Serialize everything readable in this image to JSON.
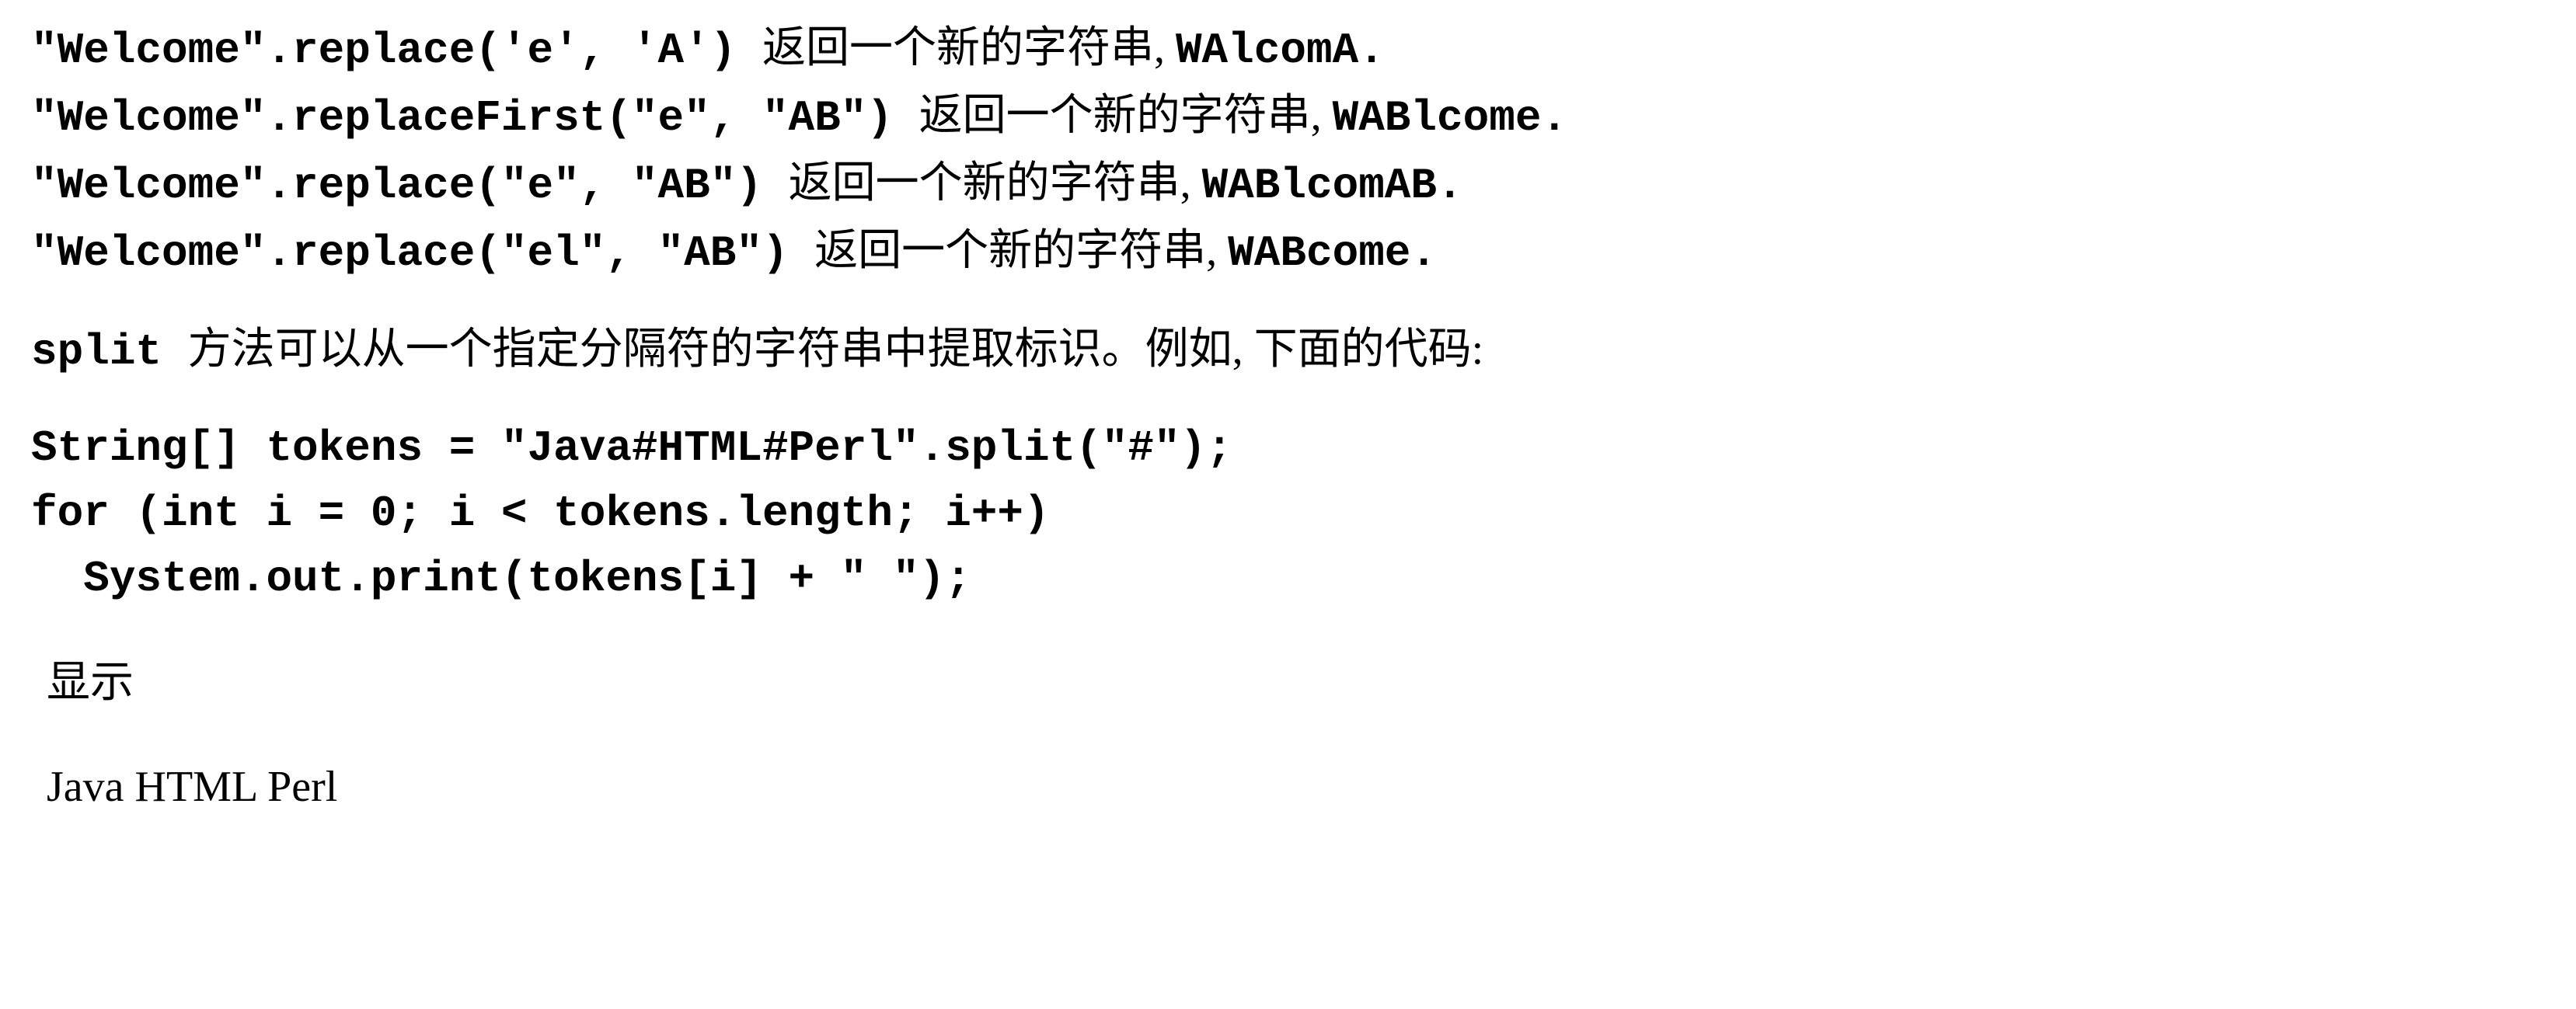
{
  "examples": [
    {
      "code": "\"Welcome\".replace('e', 'A') ",
      "cn": "返回一个新的字符串, ",
      "result": "WAlcomA."
    },
    {
      "code": "\"Welcome\".replaceFirst(\"e\", \"AB\") ",
      "cn": "返回一个新的字符串, ",
      "result": "WABlcome."
    },
    {
      "code": "\"Welcome\".replace(\"e\", \"AB\") ",
      "cn": "返回一个新的字符串, ",
      "result": "WABlcomAB."
    },
    {
      "code": "\"Welcome\".replace(\"el\", \"AB\") ",
      "cn": "返回一个新的字符串, ",
      "result": "WABcome."
    }
  ],
  "paragraph": {
    "code_prefix": "split ",
    "text": "方法可以从一个指定分隔符的字符串中提取标识。例如, 下面的代码:"
  },
  "code_block": {
    "line1": "String[] tokens = \"Java#HTML#Perl\".split(\"#\");",
    "line2": "for (int i = 0; i < tokens.length; i++)",
    "line3": "  System.out.print(tokens[i] + \" \");"
  },
  "output_label": "显示",
  "output_text": "Java HTML Perl"
}
